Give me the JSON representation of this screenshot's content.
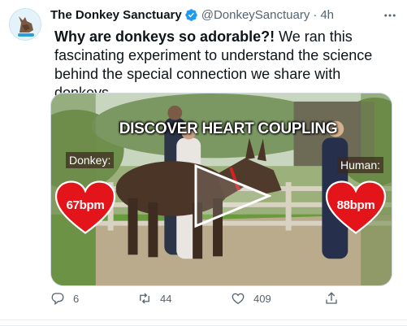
{
  "tweet": {
    "author": {
      "display_name": "The Donkey Sanctuary",
      "handle": "@DonkeySanctuary",
      "separator": "·",
      "time": "4h"
    },
    "text": {
      "lead": "Why are donkeys so adorable?!",
      "body": " We ran this fascinating experiment to understand the science behind the special connection we share with donkeys."
    },
    "media": {
      "overlay_title": "DISCOVER HEART COUPLING",
      "left_label": "Donkey:",
      "left_bpm": "67bpm",
      "right_label": "Human:",
      "right_bpm": "88bpm"
    },
    "actions": {
      "reply_count": "6",
      "retweet_count": "44",
      "like_count": "409"
    }
  },
  "colors": {
    "verified": "#1d9bf0",
    "heart": "#e3151b",
    "icon": "#536471"
  },
  "icons": {
    "verified": "verified-badge-icon",
    "more": "more-icon",
    "reply": "reply-icon",
    "retweet": "retweet-icon",
    "like": "heart-icon",
    "share": "share-icon",
    "play": "play-icon"
  }
}
